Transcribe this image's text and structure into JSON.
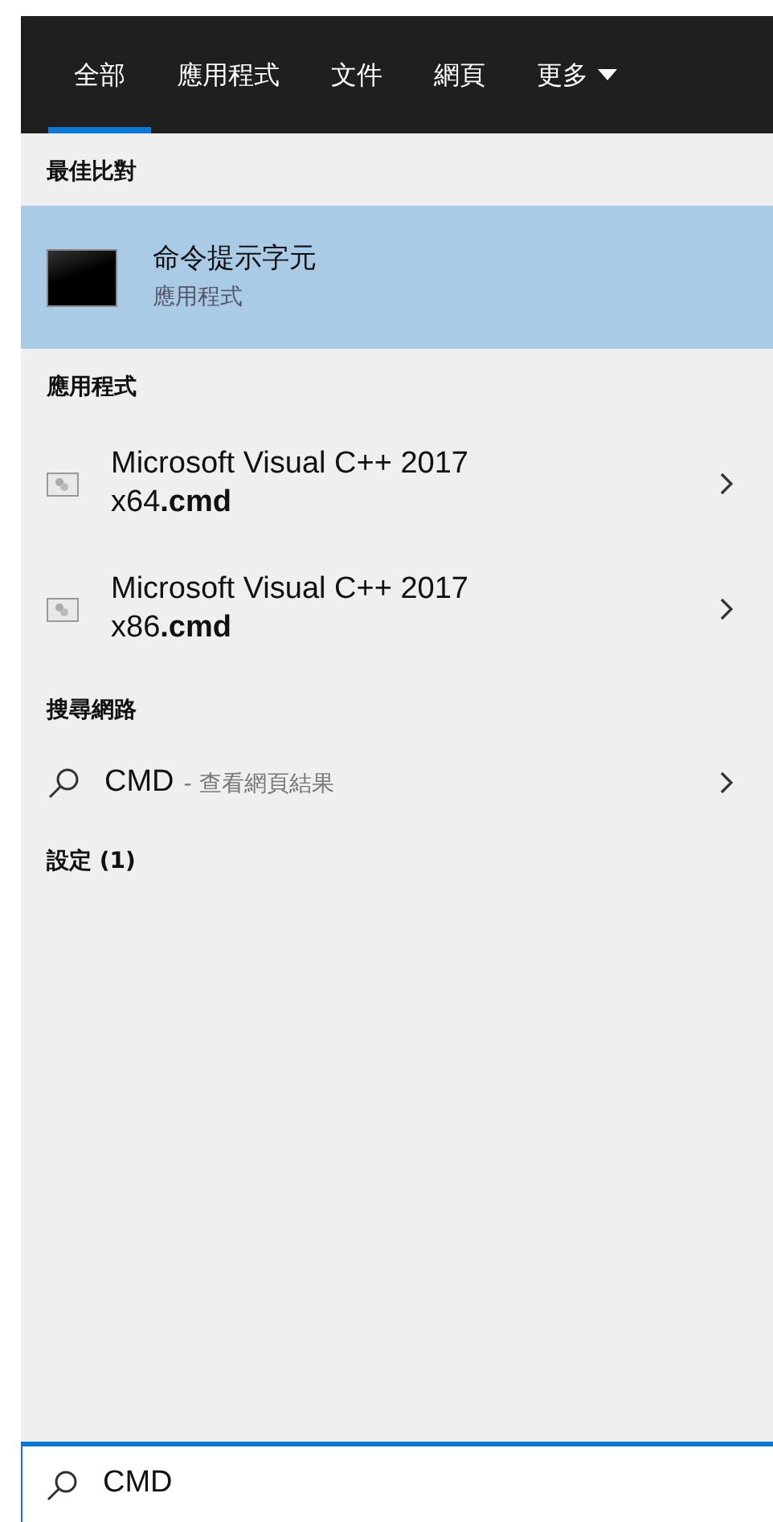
{
  "tabs": [
    {
      "label": "全部",
      "selected": true
    },
    {
      "label": "應用程式",
      "selected": false
    },
    {
      "label": "文件",
      "selected": false
    },
    {
      "label": "網頁",
      "selected": false
    },
    {
      "label": "更多",
      "selected": false,
      "kind": "dropdown"
    }
  ],
  "best_match": {
    "heading": "最佳比對",
    "title": "命令提示字元",
    "subtitle": "應用程式",
    "selected": true
  },
  "apps": {
    "heading": "應用程式",
    "items": [
      {
        "title": "Microsoft Visual C++ 2017 x64**.cmd**"
      },
      {
        "title": "Microsoft Visual C++ 2017 x86**.cmd**"
      }
    ]
  },
  "web": {
    "heading": "搜尋網路",
    "query": "CMD",
    "suffix": "- 查看網頁結果"
  },
  "settings": {
    "heading": "設定 (1)"
  },
  "search": {
    "value": "CMD"
  }
}
